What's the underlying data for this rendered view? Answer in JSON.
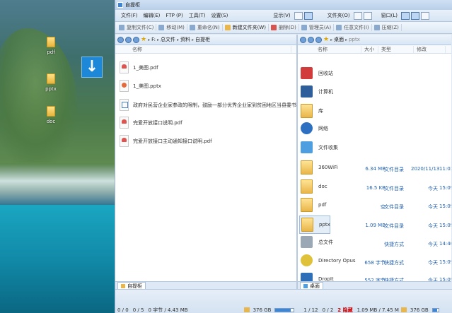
{
  "desktop": {
    "icons": [
      {
        "label": "pdf"
      },
      {
        "label": "pptx"
      },
      {
        "label": "doc"
      }
    ]
  },
  "window": {
    "title": "自提柜",
    "menu": [
      "文件(F)",
      "编辑(E)",
      "FTP (P)",
      "工具(T)",
      "设置(S)"
    ],
    "menu_right": [
      "显示(V)",
      "文件夹(O)",
      "窗口(L)"
    ],
    "toolbar": [
      "复制文件(C)",
      "移动(M)",
      "重命名(N)",
      "新建文件夹(W)",
      "删除(D)",
      "管理员(A)",
      "任意文件(I)",
      "压缩(Z)"
    ]
  },
  "left_pane": {
    "path": [
      "F:",
      "总文件",
      "资料",
      "自提柜"
    ],
    "column_name": "名称",
    "files": [
      {
        "name": "1_美图.pdf",
        "kind": "pdf"
      },
      {
        "name": "1_美图.pptx",
        "kind": "ppt"
      },
      {
        "name": "政府对民营企业家参政的限制，鼓励一部分优秀企业家到贫困地区当县委书记",
        "kind": "doc"
      },
      {
        "name": "完爱开放接口说明.pdf",
        "kind": "pdf"
      },
      {
        "name": "完爱开放接口主动通知接口说明.pdf",
        "kind": "pdf"
      }
    ],
    "tab": "自提柜",
    "status": {
      "selected": "0 / 0",
      "files": "0 / 5",
      "bytes": "0 字节 / 4.43 MB",
      "free": "376 GB",
      "free_fill": 0.82
    }
  },
  "right_pane": {
    "path": [
      "桌面",
      "pptx"
    ],
    "columns": [
      "名称",
      "大小",
      "类型",
      "修改"
    ],
    "items": [
      {
        "name": "回收站",
        "kind": "recycle",
        "size": "",
        "type": "",
        "date": "",
        "time": ""
      },
      {
        "name": "计算机",
        "kind": "computer",
        "size": "",
        "type": "",
        "date": "",
        "time": ""
      },
      {
        "name": "库",
        "kind": "library",
        "size": "",
        "type": "",
        "date": "",
        "time": ""
      },
      {
        "name": "网络",
        "kind": "network",
        "size": "",
        "type": "",
        "date": "",
        "time": ""
      },
      {
        "name": "文件收集",
        "kind": "collect",
        "size": "",
        "type": "",
        "date": "",
        "time": ""
      },
      {
        "name": "360WiFi",
        "kind": "folder",
        "size": "6.34 MB",
        "type": "文件目录",
        "date": "2020/11/13",
        "time": "11:03"
      },
      {
        "name": "doc",
        "kind": "folder",
        "size": "16.5 KB",
        "type": "文件目录",
        "date": "今天",
        "time": "15:09"
      },
      {
        "name": "pdf",
        "kind": "folder",
        "size": "空",
        "type": "文件目录",
        "date": "今天",
        "time": "15:09"
      },
      {
        "name": "pptx",
        "kind": "folder",
        "size": "1.09 MB",
        "type": "文件目录",
        "date": "今天",
        "time": "15:09"
      },
      {
        "name": "总文件",
        "kind": "shortcut",
        "size": "",
        "type": "快捷方式",
        "date": "今天",
        "time": "14:40"
      },
      {
        "name": "Directory Opus",
        "kind": "opus",
        "size": "658 字节",
        "type": "快捷方式",
        "date": "今天",
        "time": "15:09"
      },
      {
        "name": "DropIt",
        "kind": "dropit",
        "size": "552 字节",
        "type": "快捷方式",
        "date": "今天",
        "time": "15:09"
      }
    ],
    "tab": "桌面",
    "status": {
      "selected": "1 / 12",
      "files": "0 / 2",
      "hidden": "2 隐藏",
      "bytes": "1.09 MB / 7.45 M",
      "free": "376 GB",
      "free_fill": 0.82
    }
  }
}
